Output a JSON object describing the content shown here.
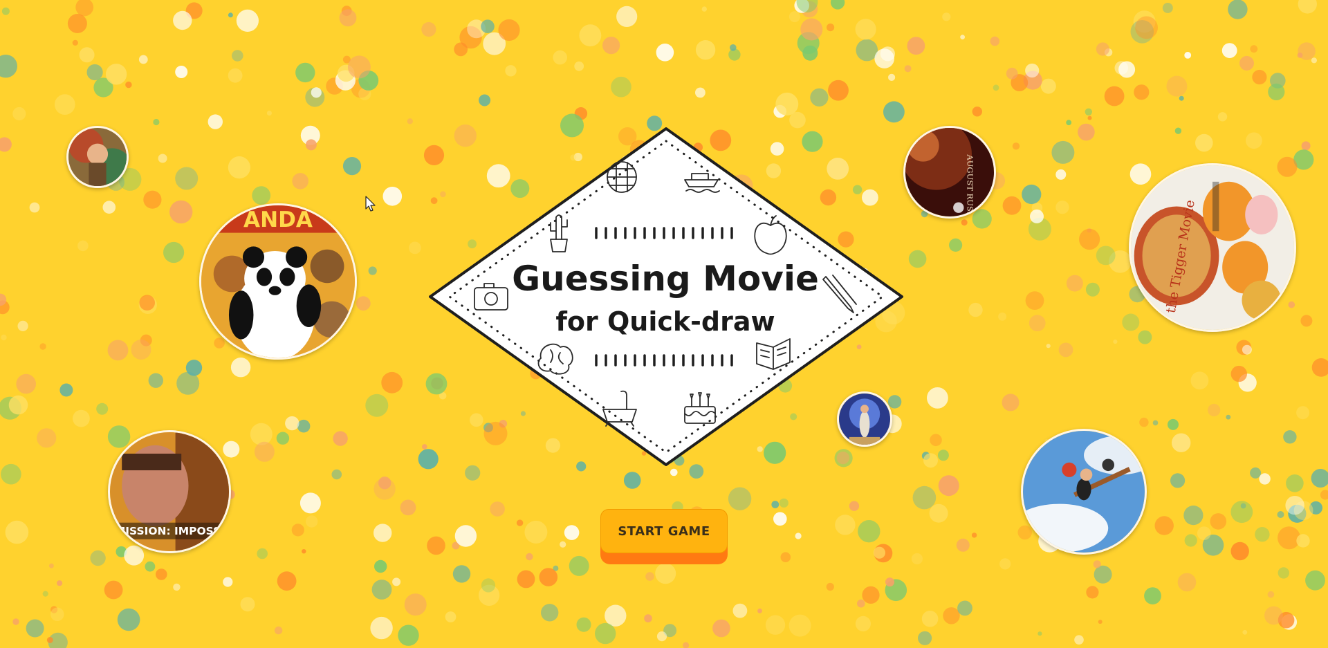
{
  "title": {
    "line1": "Guessing Movie",
    "line2": "for Quick-draw"
  },
  "start_button": {
    "label": "START GAME"
  },
  "posters": [
    {
      "name": "poster-small-jungle",
      "title_text": ""
    },
    {
      "name": "poster-kung-fu-panda",
      "title_text": "ANDA"
    },
    {
      "name": "poster-mission-impossible",
      "title_text": "MISSION: IMPOSSI"
    },
    {
      "name": "poster-august-rush",
      "title_text": "AUGUST RUSH"
    },
    {
      "name": "poster-tigger-movie",
      "title_text": "the Tigger Movie"
    },
    {
      "name": "poster-kikis-delivery",
      "title_text": ""
    },
    {
      "name": "poster-small-blue",
      "title_text": ""
    }
  ],
  "icons": [
    "basket-icon",
    "boat-icon",
    "cactus-icon",
    "apple-icon",
    "camera-icon",
    "pencil-icon",
    "brain-icon",
    "book-icon",
    "bathtub-icon",
    "cake-icon",
    "cursor-icon"
  ],
  "colors": {
    "background": "#ffd22e",
    "button": "#ffb30f",
    "button_shadow": "#ff7a12",
    "ink": "#1a1a1a",
    "confetti": [
      "#ff8c2a",
      "#7bc96f",
      "#ffe066",
      "#f7a26a",
      "#5bb0a8",
      "#ffffff"
    ]
  }
}
